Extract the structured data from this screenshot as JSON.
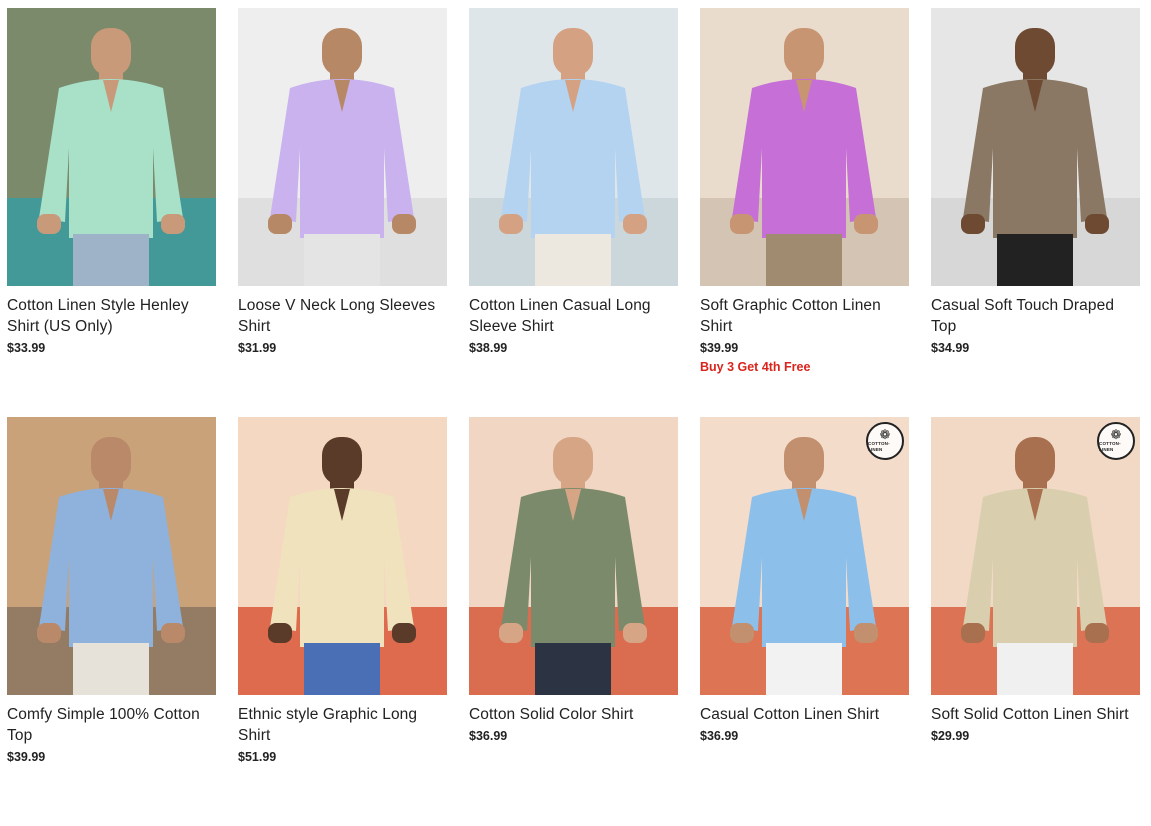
{
  "products": [
    {
      "title": "Cotton Linen Style Henley Shirt (US Only)",
      "price": "$33.99",
      "promo": "",
      "colors": {
        "bg": "#7a8a6a",
        "bg2": "#3a9aa0",
        "shirt": "#a8e0c8",
        "pants": "#9fb3c8",
        "skin": "#c89a7a"
      },
      "badge": ""
    },
    {
      "title": "Loose V Neck Long Sleeves Shirt",
      "price": "$31.99",
      "promo": "",
      "colors": {
        "bg": "#eeeeee",
        "bg2": "#dcdcdc",
        "shirt": "#c9b2ee",
        "pants": "#e4e4e4",
        "skin": "#b78865"
      },
      "badge": ""
    },
    {
      "title": "Cotton Linen Casual Long Sleeve Shirt",
      "price": "$38.99",
      "promo": "",
      "colors": {
        "bg": "#dfe6ea",
        "bg2": "#c9d3d8",
        "shirt": "#b3d3f0",
        "pants": "#ece7df",
        "skin": "#d4a283"
      },
      "badge": ""
    },
    {
      "title": "Soft Graphic Cotton Linen Shirt",
      "price": "$39.99",
      "promo": "Buy 3 Get 4th Free",
      "colors": {
        "bg": "#e9dccd",
        "bg2": "#cfc0ae",
        "shirt": "#c66fd6",
        "pants": "#a08a70",
        "skin": "#c89572"
      },
      "badge": ""
    },
    {
      "title": "Casual Soft Touch Draped Top",
      "price": "$34.99",
      "promo": "",
      "colors": {
        "bg": "#e6e6e6",
        "bg2": "#d4d4d4",
        "shirt": "#8a7864",
        "pants": "#222222",
        "skin": "#6e4a33"
      },
      "badge": ""
    },
    {
      "title": "Comfy Simple 100% Cotton Top",
      "price": "$39.99",
      "promo": "",
      "colors": {
        "bg": "#c9a27a",
        "bg2": "#8a7460",
        "shirt": "#8fb2dc",
        "pants": "#e6e2da",
        "skin": "#b9896a"
      },
      "badge": ""
    },
    {
      "title": "Ethnic style Graphic Long Shirt",
      "price": "$51.99",
      "promo": "",
      "colors": {
        "bg": "#f4d8c2",
        "bg2": "#d9583a",
        "shirt": "#efe2bd",
        "pants": "#4a6fb5",
        "skin": "#5a3a28"
      },
      "badge": ""
    },
    {
      "title": "Cotton Solid Color Shirt",
      "price": "$36.99",
      "promo": "",
      "colors": {
        "bg": "#f1d6c4",
        "bg2": "#d65a3c",
        "shirt": "#7b8a6a",
        "pants": "#2c3444",
        "skin": "#d6a585"
      },
      "badge": ""
    },
    {
      "title": "Casual Cotton Linen Shirt",
      "price": "$36.99",
      "promo": "",
      "colors": {
        "bg": "#f4dccb",
        "bg2": "#d8623f",
        "shirt": "#8cbfea",
        "pants": "#f2f2f2",
        "skin": "#c2906e"
      },
      "badge": "COTTON-LINEN"
    },
    {
      "title": "Soft Solid Cotton Linen Shirt",
      "price": "$29.99",
      "promo": "",
      "colors": {
        "bg": "#f2d9c6",
        "bg2": "#d86040",
        "shirt": "#d9cfae",
        "pants": "#f0f0f0",
        "skin": "#a9704f"
      },
      "badge": "COTTON-LINEN"
    }
  ]
}
